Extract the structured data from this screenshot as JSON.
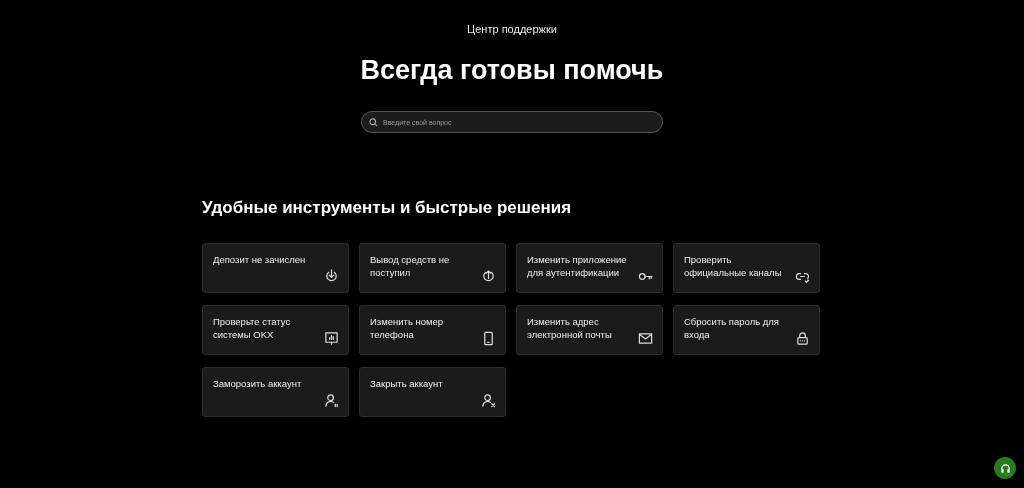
{
  "header": {
    "eyebrow": "Центр поддержки",
    "title": "Всегда готовы помочь"
  },
  "search": {
    "placeholder": "Введите свой вопрос"
  },
  "section": {
    "title": "Удобные инструменты и быстрые решения"
  },
  "cards": [
    {
      "label": "Депозит не зачислен",
      "kind": "deposit"
    },
    {
      "label": "Вывод средств не поступил",
      "kind": "withdraw"
    },
    {
      "label": "Изменить приложение для аутентификации",
      "kind": "key"
    },
    {
      "label": "Проверить официальные каналы",
      "kind": "link"
    },
    {
      "label": "Проверьте статус системы OKX",
      "kind": "status"
    },
    {
      "label": "Изменить номер телефона",
      "kind": "phone"
    },
    {
      "label": "Изменить адрес электронной почты",
      "kind": "mail"
    },
    {
      "label": "Сбросить пароль для входа",
      "kind": "lock"
    },
    {
      "label": "Заморозить аккаунт",
      "kind": "freeze"
    },
    {
      "label": "Закрыть аккаунт",
      "kind": "close"
    }
  ]
}
